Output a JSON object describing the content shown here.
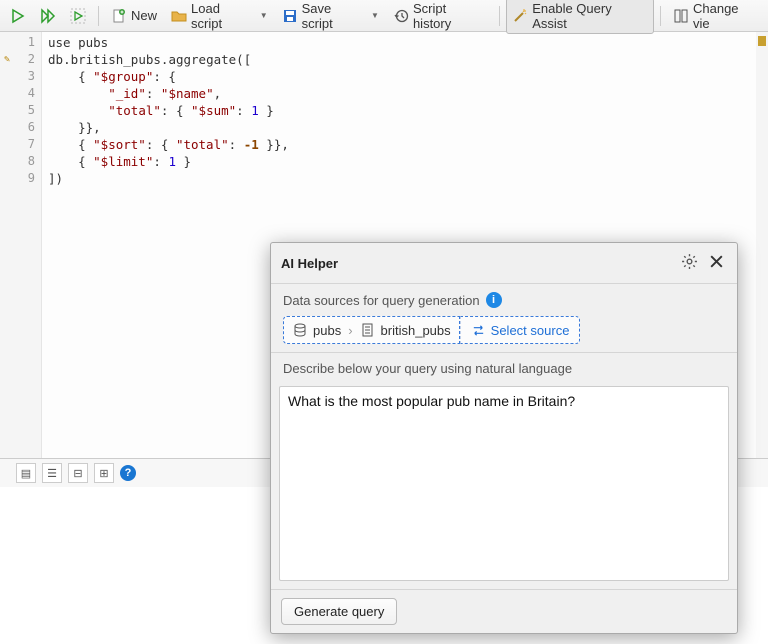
{
  "toolbar": {
    "new_label": "New",
    "load_label": "Load script",
    "save_label": "Save script",
    "history_label": "Script history",
    "query_assist_label": "Enable Query Assist",
    "change_view_label": "Change vie"
  },
  "editor": {
    "lines": [
      "1",
      "2",
      "3",
      "4",
      "5",
      "6",
      "7",
      "8",
      "9"
    ],
    "code_tokens": [
      [
        {
          "t": "use ",
          "c": "kw"
        },
        {
          "t": "pubs",
          "c": "prop"
        }
      ],
      [
        {
          "t": "db",
          "c": "prop"
        },
        {
          "t": ".",
          "c": "punc"
        },
        {
          "t": "british_pubs",
          "c": "prop"
        },
        {
          "t": ".",
          "c": "punc"
        },
        {
          "t": "aggregate",
          "c": "prop"
        },
        {
          "t": "([",
          "c": "punc"
        }
      ],
      [
        {
          "t": "    { ",
          "c": "punc"
        },
        {
          "t": "\"$group\"",
          "c": "str"
        },
        {
          "t": ": {",
          "c": "punc"
        }
      ],
      [
        {
          "t": "        ",
          "c": "punc"
        },
        {
          "t": "\"_id\"",
          "c": "str"
        },
        {
          "t": ": ",
          "c": "punc"
        },
        {
          "t": "\"$name\"",
          "c": "str"
        },
        {
          "t": ",",
          "c": "punc"
        }
      ],
      [
        {
          "t": "        ",
          "c": "punc"
        },
        {
          "t": "\"total\"",
          "c": "str"
        },
        {
          "t": ": { ",
          "c": "punc"
        },
        {
          "t": "\"$sum\"",
          "c": "str"
        },
        {
          "t": ": ",
          "c": "punc"
        },
        {
          "t": "1",
          "c": "num"
        },
        {
          "t": " }",
          "c": "punc"
        }
      ],
      [
        {
          "t": "    }},",
          "c": "punc"
        }
      ],
      [
        {
          "t": "    { ",
          "c": "punc"
        },
        {
          "t": "\"$sort\"",
          "c": "str"
        },
        {
          "t": ": { ",
          "c": "punc"
        },
        {
          "t": "\"total\"",
          "c": "str"
        },
        {
          "t": ": ",
          "c": "punc"
        },
        {
          "t": "-1",
          "c": "op"
        },
        {
          "t": " }},",
          "c": "punc"
        }
      ],
      [
        {
          "t": "    { ",
          "c": "punc"
        },
        {
          "t": "\"$limit\"",
          "c": "str"
        },
        {
          "t": ": ",
          "c": "punc"
        },
        {
          "t": "1",
          "c": "num"
        },
        {
          "t": " }",
          "c": "punc"
        }
      ],
      [
        {
          "t": "])",
          "c": "punc"
        }
      ]
    ]
  },
  "ai": {
    "title": "AI Helper",
    "sources_label": "Data sources for query generation",
    "source_db": "pubs",
    "source_coll": "british_pubs",
    "select_source_label": "Select source",
    "describe_label": "Describe below your query using natural language",
    "query_text": "What is the most popular pub name in Britain?",
    "generate_label": "Generate query"
  }
}
